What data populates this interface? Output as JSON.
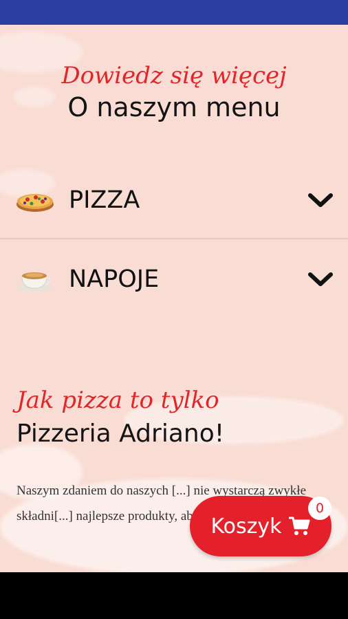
{
  "header": {
    "kicker": "Dowiedz się więcej",
    "title": "O naszym menu"
  },
  "menu": {
    "items": [
      {
        "label": "PIZZA",
        "icon": "pizza-icon"
      },
      {
        "label": "NAPOJE",
        "icon": "coffee-cup-icon"
      }
    ]
  },
  "about": {
    "kicker": "Jak pizza to tylko",
    "title": "Pizzeria Adriano!",
    "text": "Naszym zdaniem do naszych [...] nie wystarczą zwykłe składni[...] najlepsze produkty, aby były [...]"
  },
  "cart": {
    "label": "Koszyk",
    "count": "0"
  },
  "colors": {
    "accent": "#e4212b",
    "status_bar": "#2b3fa0",
    "background": "#f9dcd3"
  }
}
